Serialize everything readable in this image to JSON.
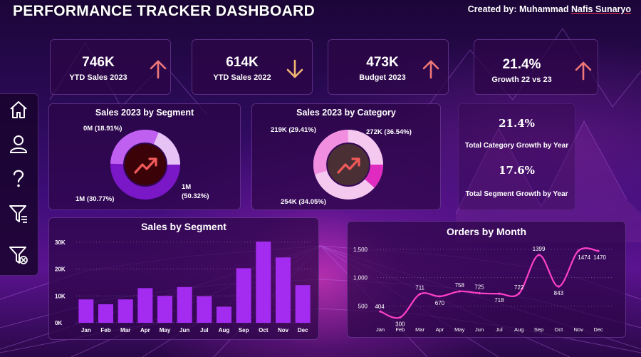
{
  "header": {
    "title": "PERFORMANCE TRACKER DASHBOARD",
    "credit_prefix": "Created by: Muhammad ",
    "credit_name": "Nafis Sunaryo"
  },
  "kpis": [
    {
      "value": "746K",
      "label": "YTD Sales 2023",
      "trend": "up",
      "color": "#f07878"
    },
    {
      "value": "614K",
      "label": "YTD Sales 2022",
      "trend": "down",
      "color": "#f2b870"
    },
    {
      "value": "473K",
      "label": "Budget 2023",
      "trend": "up",
      "color": "#f07878"
    },
    {
      "value": "21.4%",
      "label": "Growth 22 vs 23",
      "trend": "up",
      "color": "#f07878"
    }
  ],
  "sidebar": {
    "items": [
      {
        "icon": "home-icon"
      },
      {
        "icon": "user-icon"
      },
      {
        "icon": "help-icon"
      },
      {
        "icon": "filter-icon"
      },
      {
        "icon": "clear-filter-icon"
      }
    ]
  },
  "segment_donut": {
    "title": "Sales 2023 by Segment",
    "labels": [
      "0M (18.91%)",
      "1M (30.77%)",
      "1M",
      "(50.32%)"
    ],
    "colors": [
      "#e6c2f5",
      "#c060f0",
      "#7a18c8"
    ]
  },
  "category_donut": {
    "title": "Sales 2023 by Category",
    "labels": [
      "219K (29.41%)",
      "272K (36.54%)",
      "254K (34.05%)"
    ],
    "colors": [
      "#f28ee0",
      "#e02bc0",
      "#f5c8ef"
    ]
  },
  "growth_stats": {
    "category_value": "21.4%",
    "category_label": "Total Category Growth by Year",
    "segment_value": "17.6%",
    "segment_label": "Total Segment Growth by Year"
  },
  "chart_data": [
    {
      "type": "bar",
      "title": "Sales by Segment",
      "categories": [
        "Jan",
        "Feb",
        "Mar",
        "Apr",
        "May",
        "Jun",
        "Jul",
        "Aug",
        "Sep",
        "Oct",
        "Nov",
        "Dec"
      ],
      "values": [
        8700,
        6900,
        8700,
        12900,
        10000,
        13300,
        9900,
        6000,
        20300,
        30200,
        24300,
        14000
      ],
      "yticks": [
        "0K",
        "10K",
        "20K",
        "30K"
      ],
      "ylim": [
        0,
        31000
      ],
      "grid": true,
      "color": "#a32cf0"
    },
    {
      "type": "line",
      "title": "Orders by Month",
      "categories": [
        "Jan",
        "Feb",
        "Mar",
        "Apr",
        "May",
        "Jun",
        "Jul",
        "Aug",
        "Sep",
        "Oct",
        "Nov",
        "Dec"
      ],
      "values": [
        404,
        300,
        711,
        670,
        758,
        725,
        718,
        722,
        1399,
        843,
        1474,
        1470
      ],
      "data_labels": [
        "404",
        "300",
        "711",
        "670",
        "758",
        "725",
        "718",
        "722",
        "1399",
        "843",
        "1474",
        "1470"
      ],
      "yticks": [
        "500",
        "1,000",
        "1,500"
      ],
      "ytick_values": [
        500,
        1000,
        1500
      ],
      "ylim": [
        230,
        1560
      ],
      "grid": true,
      "color": "#ff40c8"
    }
  ]
}
